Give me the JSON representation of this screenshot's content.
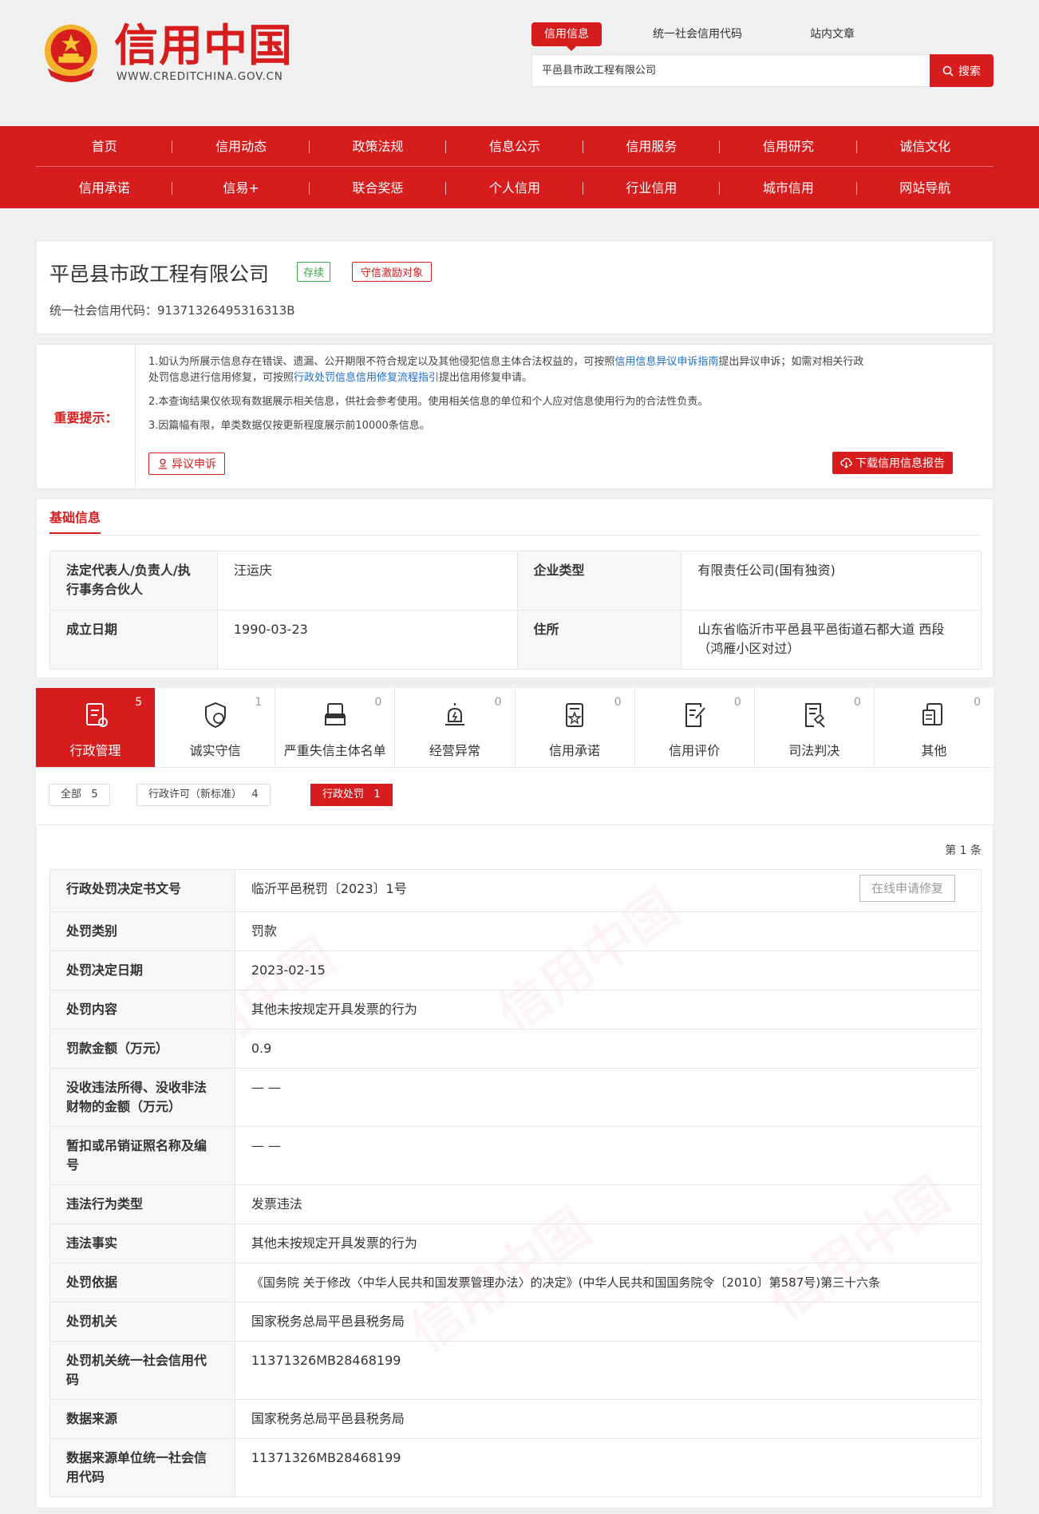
{
  "header": {
    "logo_text": "信用中国",
    "logo_url": "WWW.CREDITCHINA.GOV.CN",
    "search_tabs": [
      "信用信息",
      "统一社会信用代码",
      "站内文章"
    ],
    "search_value": "平邑县市政工程有限公司",
    "search_button": "搜索"
  },
  "nav": {
    "row1": [
      "首页",
      "信用动态",
      "政策法规",
      "信息公示",
      "信用服务",
      "信用研究",
      "诚信文化"
    ],
    "row2": [
      "信用承诺",
      "信易+",
      "联合奖惩",
      "个人信用",
      "行业信用",
      "城市信用",
      "网站导航"
    ]
  },
  "company": {
    "name": "平邑县市政工程有限公司",
    "status": "存续",
    "tag": "守信激励对象",
    "code_label": "统一社会信用代码：",
    "code": "91371326495316313B"
  },
  "notice": {
    "label": "重要提示：",
    "l1a": "1.如认为所展示信息存在错误、遗漏、公开期限不符合规定以及其他侵犯信息主体合法权益的，可按照",
    "l1link": "信用信息异议申诉指南",
    "l1b": "提出异议申诉；如需对相关行政",
    "l1c": "处罚信息进行信用修复，可按照",
    "l1link2": "行政处罚信息信用修复流程指引",
    "l1d": "提出信用修复申请。",
    "l2": "2.本查询结果仅依现有数据展示相关信息，供社会参考使用。使用相关信息的单位和个人应对信息使用行为的合法性负责。",
    "l3": "3.因篇幅有限，单类数据仅按更新程度展示前10000条信息。",
    "appeal": "异议申诉",
    "download": "下载信用信息报告"
  },
  "basic": {
    "title": "基础信息",
    "rows": [
      {
        "k1": "法定代表人/负责人/执行事务合伙人",
        "v1": "汪运庆",
        "k2": "企业类型",
        "v2": "有限责任公司(国有独资)"
      },
      {
        "k1": "成立日期",
        "v1": "1990-03-23",
        "k2": "住所",
        "v2": "山东省临沂市平邑县平邑街道石都大道 西段（鸿雁小区对过）"
      }
    ]
  },
  "tabs": [
    {
      "label": "行政管理",
      "count": "5",
      "icon": "admin-icon"
    },
    {
      "label": "诚实守信",
      "count": "1",
      "icon": "honest-shield-icon"
    },
    {
      "label": "严重失信主体名单",
      "count": "0",
      "icon": "dishonest-person-icon"
    },
    {
      "label": "经营异常",
      "count": "0",
      "icon": "alarm-icon"
    },
    {
      "label": "信用承诺",
      "count": "0",
      "icon": "promise-doc-icon"
    },
    {
      "label": "信用评价",
      "count": "0",
      "icon": "evaluate-doc-icon"
    },
    {
      "label": "司法判决",
      "count": "0",
      "icon": "judge-doc-icon"
    },
    {
      "label": "其他",
      "count": "0",
      "icon": "other-doc-icon"
    }
  ],
  "subtabs": [
    {
      "label": "全部",
      "count": "5"
    },
    {
      "label": "行政许可（新标准）",
      "count": "4"
    },
    {
      "label": "行政处罚",
      "count": "1"
    }
  ],
  "penalty": {
    "page_info": "第 1 条",
    "repair_button": "在线申请修复",
    "rows": [
      {
        "k": "行政处罚决定书文号",
        "v": "临沂平邑税罚〔2023〕1号"
      },
      {
        "k": "处罚类别",
        "v": "罚款"
      },
      {
        "k": "处罚决定日期",
        "v": "2023-02-15"
      },
      {
        "k": "处罚内容",
        "v": "其他未按规定开具发票的行为"
      },
      {
        "k": "罚款金额（万元）",
        "v": "0.9"
      },
      {
        "k": "没收违法所得、没收非法财物的金额（万元）",
        "v": "— —"
      },
      {
        "k": "暂扣或吊销证照名称及编号",
        "v": "— —"
      },
      {
        "k": "违法行为类型",
        "v": "发票违法"
      },
      {
        "k": "违法事实",
        "v": "其他未按规定开具发票的行为"
      },
      {
        "k": "处罚依据",
        "v": "《国务院 关于修改〈中华人民共和国发票管理办法〉的决定》(中华人民共和国国务院令〔2010〕第587号)第三十六条"
      },
      {
        "k": "处罚机关",
        "v": "国家税务总局平邑县税务局"
      },
      {
        "k": "处罚机关统一社会信用代码",
        "v": "11371326MB28468199"
      },
      {
        "k": "数据来源",
        "v": "国家税务总局平邑县税务局"
      },
      {
        "k": "数据来源单位统一社会信用代码",
        "v": "11371326MB28468199"
      }
    ]
  },
  "colors": {
    "brand_red": "#d71c1e",
    "link_blue": "#1e6fcd",
    "status_green": "#3aa54a"
  }
}
